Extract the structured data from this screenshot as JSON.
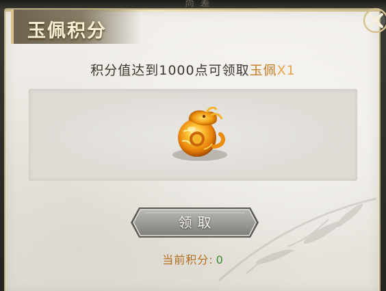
{
  "background": {
    "hint_text": "尚 差"
  },
  "dialog": {
    "title": "玉佩积分",
    "close_icon": "close-x-icon",
    "requirement": {
      "prefix": "积分值达到1000点可领取",
      "item_name": "玉佩",
      "quantity": "X1"
    },
    "reward": {
      "icon": "golden-dragon-jade-pendant-icon"
    },
    "claim_button_label": "领取",
    "current_points": {
      "label": "当前积分:",
      "value": "0"
    }
  },
  "colors": {
    "title_text": "#f7f0d6",
    "item_name": "#c27a1e",
    "quantity": "#e8a446",
    "points_label": "#b36d1e",
    "points_value": "#3d8a2e",
    "panel_border": "#b9ab84"
  }
}
